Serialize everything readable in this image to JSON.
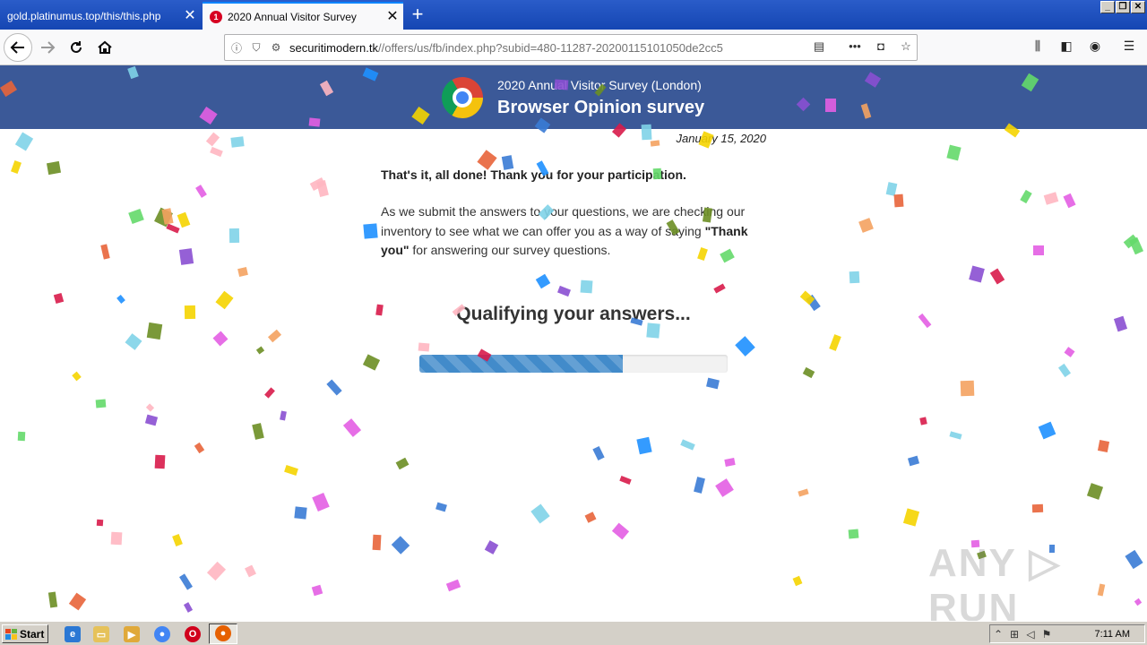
{
  "browser": {
    "tabs": [
      {
        "title": "gold.platinumus.top/this/this.php",
        "active": false
      },
      {
        "title": "2020 Annual Visitor Survey",
        "active": true,
        "badge": "1"
      }
    ],
    "url": {
      "domain": "securitimodern.tk",
      "path": "//offers/us/fb/index.php?subid=480-11287-20200115101050de2cc5"
    }
  },
  "banner": {
    "subtitle": "2020 Annual Visitor Survey (London)",
    "title": "Browser Opinion survey",
    "color": "#3b5998"
  },
  "content": {
    "date": "January 15, 2020",
    "done_message": "That's it, all done! Thank you for your participation.",
    "body_part1": "As we submit the answers to your questions, we are checking our inventory to see what we can offer you as a way of saying ",
    "body_bold": "\"Thank you\"",
    "body_part2": " for answering our survey questions.",
    "qualifying": "Qualifying your answers...",
    "progress_fraction": 0.66,
    "progress_color": "#428bca"
  },
  "watermark": "ANY RUN",
  "taskbar": {
    "start_label": "Start",
    "clock": "7:11 AM"
  }
}
